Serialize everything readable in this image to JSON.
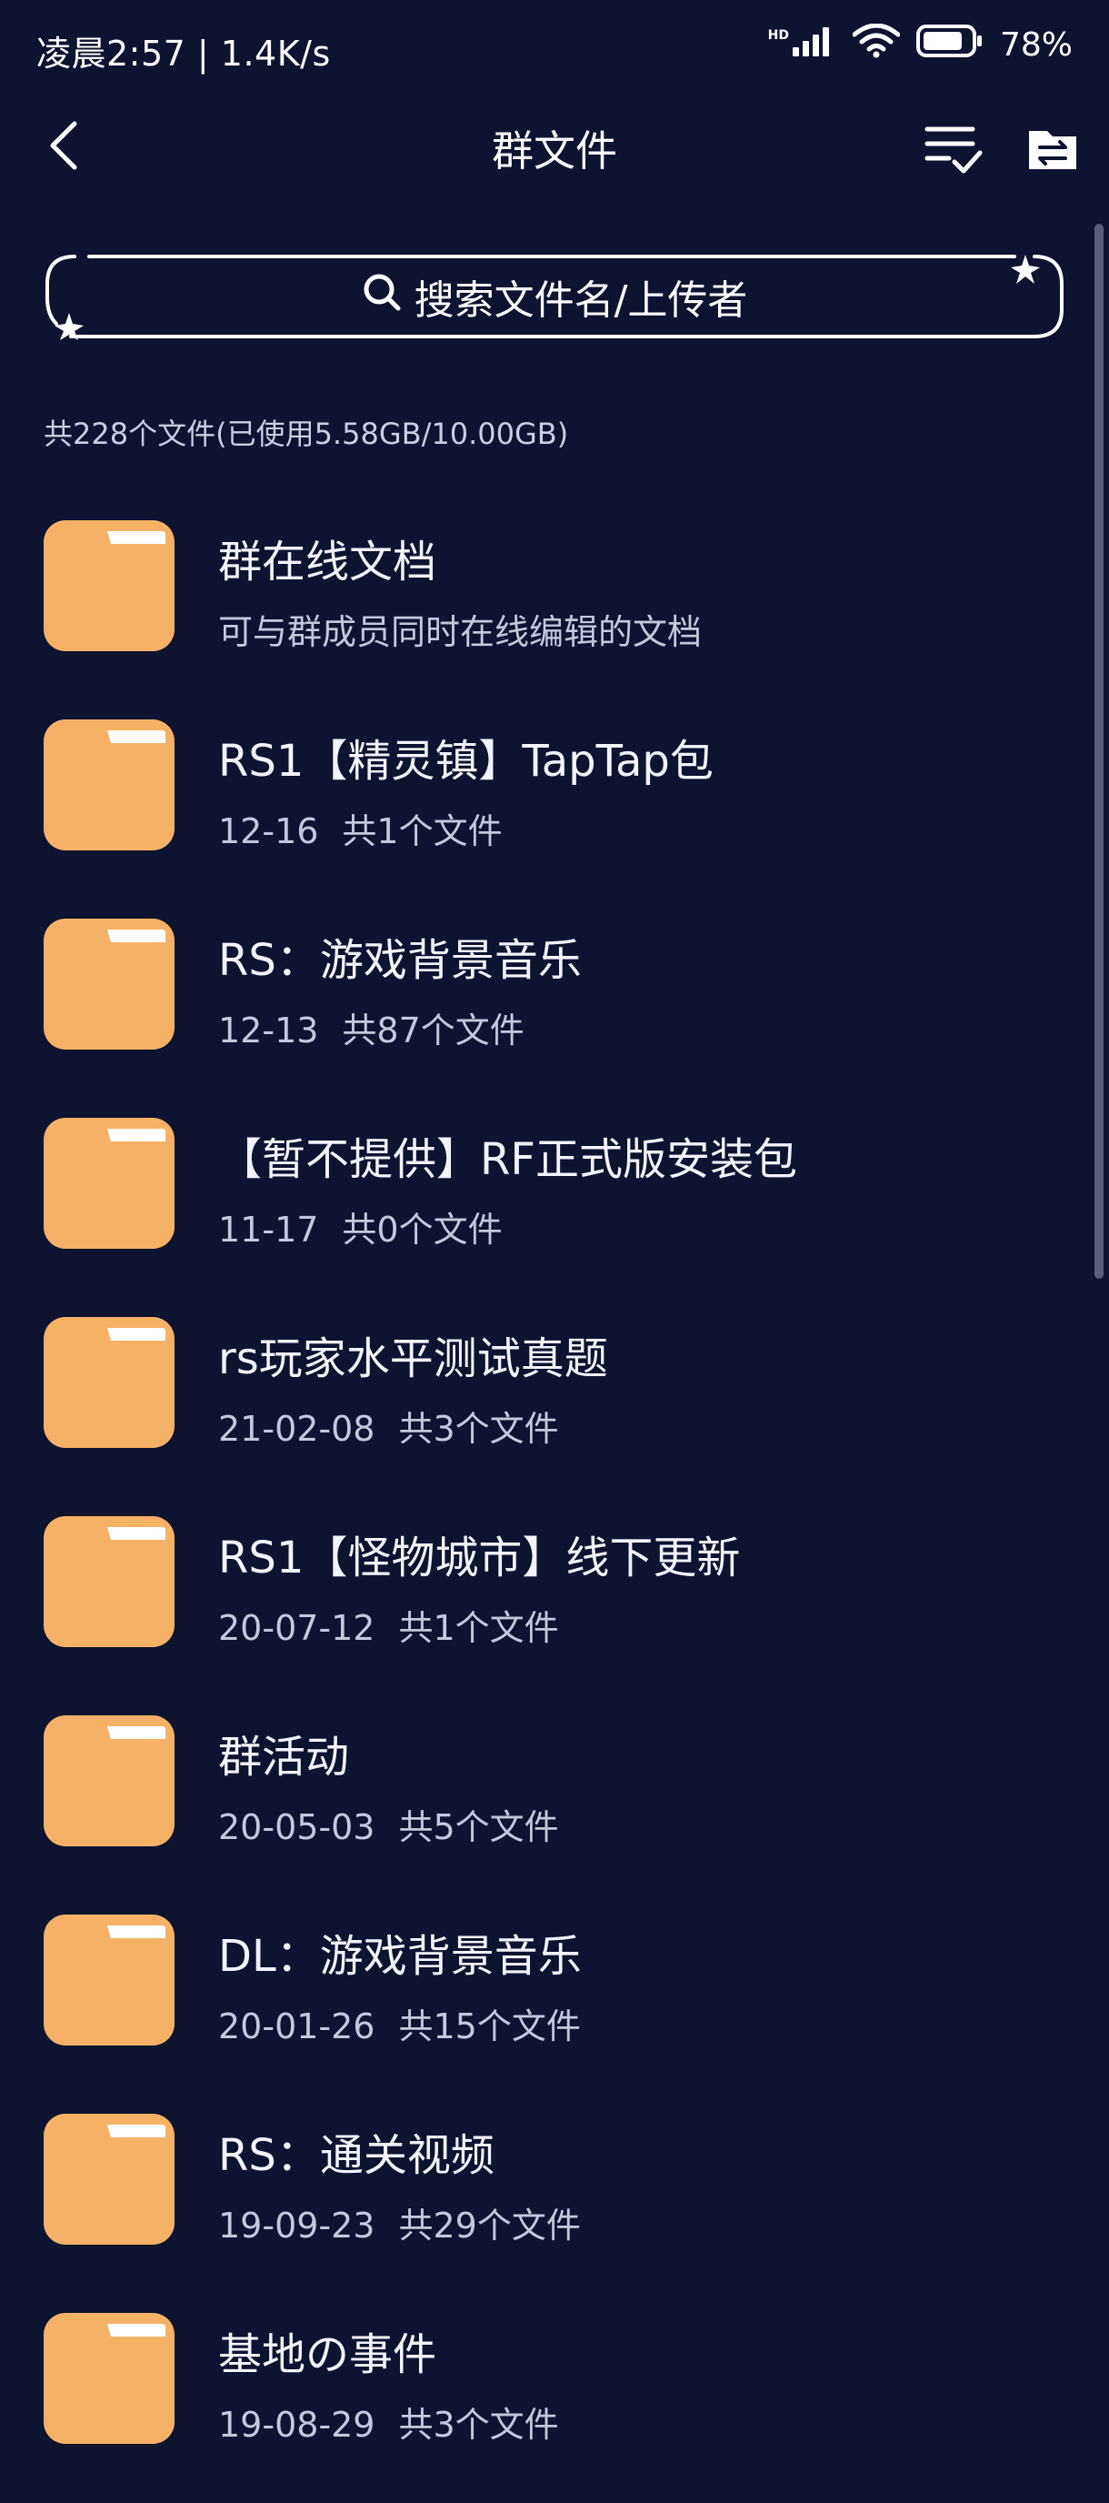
{
  "status_bar": {
    "left_text": "凌晨2:57 | 1.4K/s",
    "hd_label": "HD",
    "battery_text": "78%",
    "icons": [
      "signal-icon",
      "wifi-icon",
      "battery-icon"
    ]
  },
  "header": {
    "title": "群文件",
    "icons": [
      "back-arrow-icon",
      "checklist-icon",
      "folder-transfer-icon"
    ]
  },
  "search": {
    "placeholder": "搜索文件名/上传者"
  },
  "summary": "共228个文件(已使用5.58GB/10.00GB)",
  "colors": {
    "background": "#0e1330",
    "folder": "#f5b266",
    "text_primary": "#f2f4fb",
    "text_secondary": "#c3c8db"
  },
  "items": [
    {
      "title": "群在线文档",
      "date": "",
      "count": "可与群成员同时在线编辑的文档"
    },
    {
      "title": "RS1【精灵镇】TapTap包",
      "date": "12-16",
      "count": "共1个文件"
    },
    {
      "title": "RS：游戏背景音乐",
      "date": "12-13",
      "count": "共87个文件"
    },
    {
      "title": "【暂不提供】RF正式版安装包",
      "date": "11-17",
      "count": "共0个文件"
    },
    {
      "title": "rs玩家水平测试真题",
      "date": "21-02-08",
      "count": "共3个文件"
    },
    {
      "title": "RS1【怪物城市】线下更新",
      "date": "20-07-12",
      "count": "共1个文件"
    },
    {
      "title": "群活动",
      "date": "20-05-03",
      "count": "共5个文件"
    },
    {
      "title": "DL：游戏背景音乐",
      "date": "20-01-26",
      "count": "共15个文件"
    },
    {
      "title": "RS：通关视频",
      "date": "19-09-23",
      "count": "共29个文件"
    },
    {
      "title": "基地の事件",
      "date": "19-08-29",
      "count": "共3个文件"
    }
  ]
}
